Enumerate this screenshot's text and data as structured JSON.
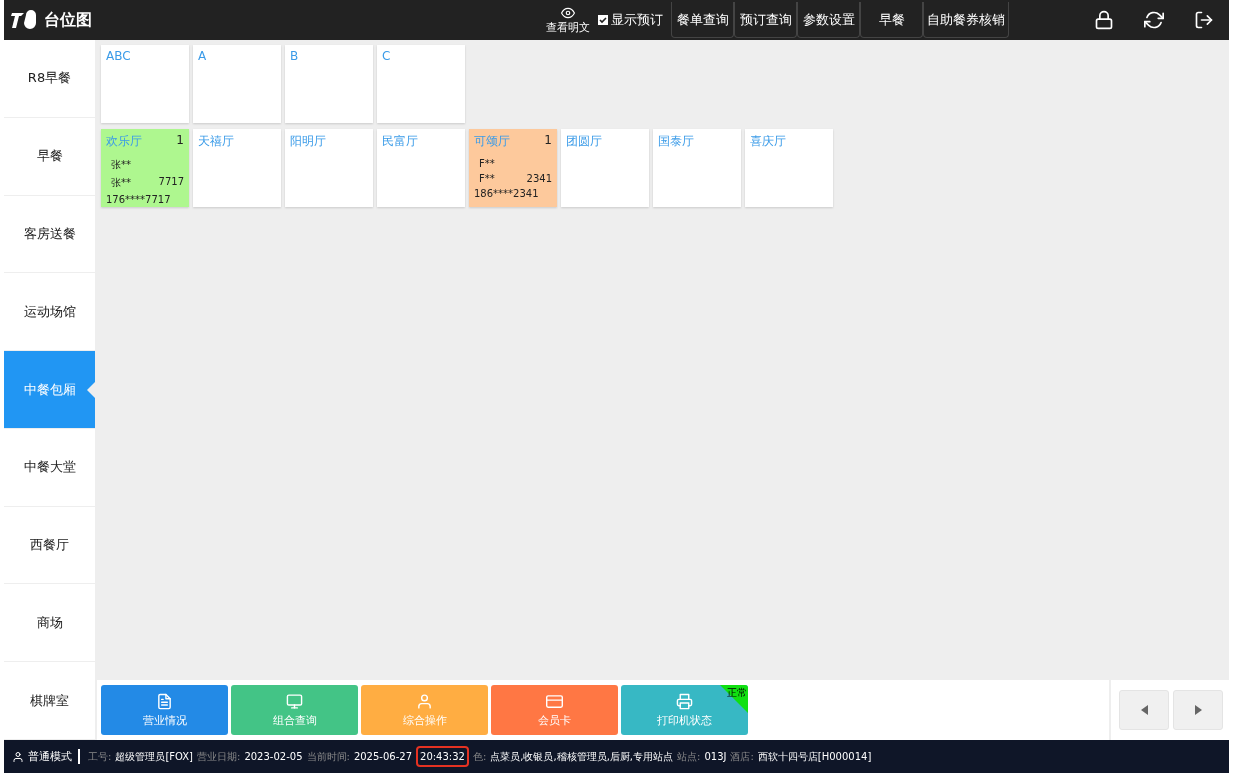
{
  "header": {
    "title": "台位图",
    "view_plain": {
      "label": "查看明文"
    },
    "show_reservation": {
      "label": "显示预订",
      "checked": true
    },
    "buttons": [
      {
        "label": "餐单查询"
      },
      {
        "label": "预订查询"
      },
      {
        "label": "参数设置"
      },
      {
        "label": "早餐"
      },
      {
        "label": "自助餐券核销"
      }
    ]
  },
  "sidebar": {
    "items": [
      {
        "label": "R8早餐",
        "selected": false
      },
      {
        "label": "早餐",
        "selected": false
      },
      {
        "label": "客房送餐",
        "selected": false
      },
      {
        "label": "运动场馆",
        "selected": false
      },
      {
        "label": "中餐包厢",
        "selected": true
      },
      {
        "label": "中餐大堂",
        "selected": false
      },
      {
        "label": "西餐厅",
        "selected": false
      },
      {
        "label": "商场",
        "selected": false
      },
      {
        "label": "棋牌室",
        "selected": false
      }
    ]
  },
  "table_rows": [
    [
      {
        "name": "ABC"
      },
      {
        "name": "A"
      },
      {
        "name": "B"
      },
      {
        "name": "C"
      }
    ],
    [
      {
        "name": "欢乐厅",
        "count": "1",
        "color": "#aef78f",
        "guest": "张**",
        "contact": "张**",
        "code": "7717",
        "phone": "176****7717"
      },
      {
        "name": "天禧厅"
      },
      {
        "name": "阳明厅"
      },
      {
        "name": "民富厅"
      },
      {
        "name": "可颂厅",
        "count": "1",
        "color": "#fdc99c",
        "guest": "F**",
        "contact": "F**",
        "code": "2341",
        "phone": "186****2341"
      },
      {
        "name": "团圆厅"
      },
      {
        "name": "国泰厅"
      },
      {
        "name": "喜庆厅"
      }
    ]
  ],
  "actions": [
    {
      "label": "营业情况",
      "kind": "report",
      "color": "#238ae6"
    },
    {
      "label": "组合查询",
      "kind": "search",
      "color": "#43c486"
    },
    {
      "label": "综合操作",
      "kind": "operate",
      "color": "#ffad42"
    },
    {
      "label": "会员卡",
      "kind": "card",
      "color": "#ff7744"
    },
    {
      "label": "打印机状态",
      "kind": "printer",
      "color": "#37b8c4",
      "badge": "正常"
    }
  ],
  "status_bar": {
    "mode": "普通模式",
    "fields": [
      {
        "label": "工号:",
        "value": "超级管理员[FOX]",
        "highlighted": false
      },
      {
        "label": "营业日期:",
        "value": "2023-02-05",
        "highlighted": false
      },
      {
        "label": "当前时间:",
        "value": "2025-06-27",
        "highlighted": false
      },
      {
        "value": "20:43:32",
        "highlighted": true
      },
      {
        "label": "色:",
        "value": "点菜员,收银员,稽核管理员,后厨,专用站点",
        "highlighted": false
      },
      {
        "label": "站点:",
        "value": "013J",
        "highlighted": false
      },
      {
        "label": "酒店:",
        "value": "西软十四号店[H000014]",
        "highlighted": false
      }
    ]
  }
}
